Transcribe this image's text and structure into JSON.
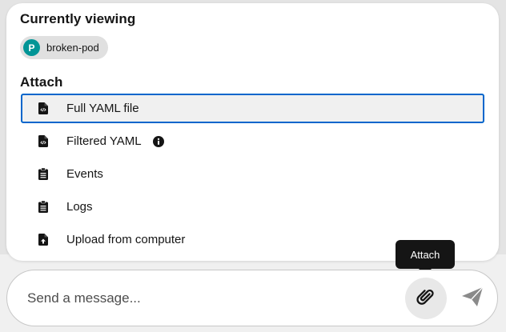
{
  "viewing": {
    "title": "Currently viewing",
    "resource": {
      "badge": "P",
      "name": "broken-pod",
      "badge_color": "#009596"
    }
  },
  "attach": {
    "title": "Attach",
    "items": [
      {
        "label": "Full YAML file",
        "icon": "file-code-icon",
        "selected": true
      },
      {
        "label": "Filtered YAML",
        "icon": "file-code-icon",
        "info": true
      },
      {
        "label": "Events",
        "icon": "clipboard-icon"
      },
      {
        "label": "Logs",
        "icon": "clipboard-icon"
      },
      {
        "label": "Upload from computer",
        "icon": "file-upload-icon"
      }
    ]
  },
  "tooltip": {
    "text": "Attach"
  },
  "message": {
    "placeholder": "Send a message..."
  },
  "colors": {
    "selected_border": "#0066cc",
    "tooltip_bg": "#151515"
  }
}
